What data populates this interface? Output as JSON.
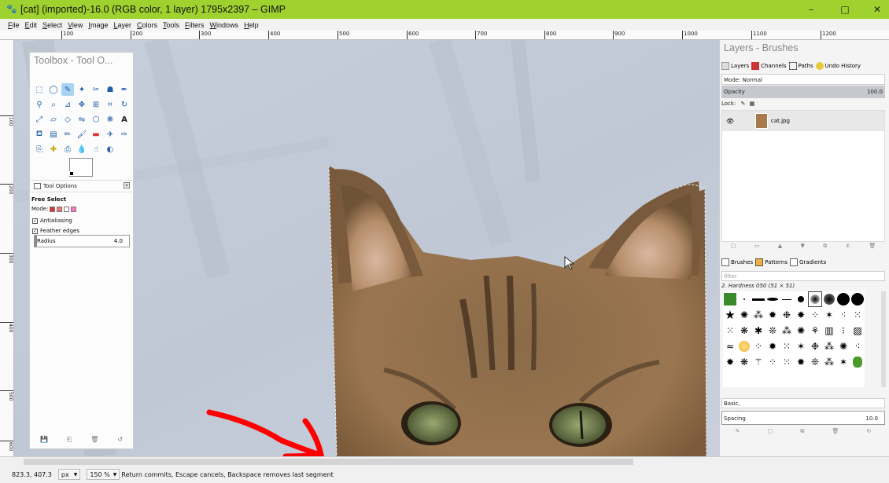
{
  "window": {
    "title": "[cat] (imported)-16.0 (RGB color, 1 layer) 1795x2397 – GIMP",
    "minimize": "–",
    "maximize": "□",
    "close": "✕"
  },
  "menu": [
    "File",
    "Edit",
    "Select",
    "View",
    "Image",
    "Layer",
    "Colors",
    "Tools",
    "Filters",
    "Windows",
    "Help"
  ],
  "ruler": {
    "h_ticks": [
      "100",
      "200",
      "300",
      "400",
      "500",
      "600",
      "700",
      "800",
      "900",
      "1000",
      "1100",
      "1200"
    ],
    "v_ticks": [
      "100",
      "200",
      "300",
      "400",
      "500",
      "600"
    ]
  },
  "toolbox": {
    "title": "Toolbox - Tool O...",
    "tool_options_tab": "Tool Options",
    "tool_name": "Free Select",
    "mode_label": "Mode:",
    "antialiasing": "Antialiasing",
    "feather": "Feather edges",
    "radius_label": "Radius",
    "radius_value": "4.0"
  },
  "dock": {
    "title": "Layers - Brushes",
    "tabs": [
      "Layers",
      "Channels",
      "Paths",
      "Undo History"
    ],
    "mode": "Mode: Normal",
    "opacity_label": "Opacity",
    "opacity_value": "100.0",
    "lock_label": "Lock:",
    "layer_name": "cat.jpg",
    "brush_tabs": [
      "Brushes",
      "Patterns",
      "Gradients"
    ],
    "filter_placeholder": "filter",
    "brush_name": "2. Hardness 050 (51 × 51)",
    "preset": "Basic,",
    "spacing_label": "Spacing",
    "spacing_value": "10.0"
  },
  "status": {
    "coords": "823.3, 407.3",
    "unit": "px",
    "zoom": "150 %",
    "message": "Return commits, Escape cancels, Backspace removes last segment"
  },
  "colors": {
    "titlebar": "#9fd12f",
    "annotation": "#ff0000",
    "canvas_bg": "#c3cbd8"
  }
}
